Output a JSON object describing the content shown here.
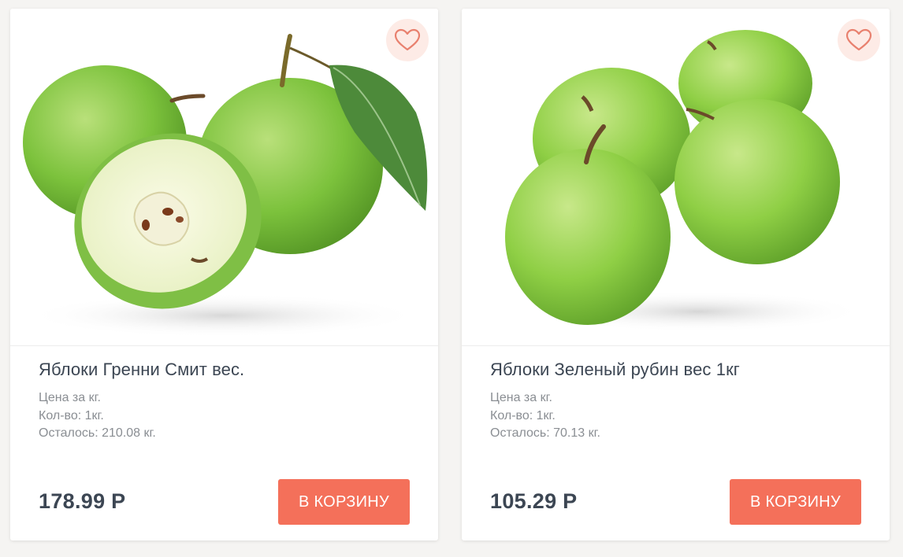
{
  "products": [
    {
      "image": "green-apples-granny-smith-with-half-and-leaf",
      "title": "Яблоки Гренни Смит вес.",
      "price_note": "Цена за кг.",
      "quantity": "Кол-во: 1кг.",
      "remaining": "Осталось: 210.08 кг.",
      "price": "178.99 Р",
      "button_label": "В КОРЗИНУ"
    },
    {
      "image": "four-green-apples-green-ruby",
      "title": "Яблоки Зеленый рубин вес 1кг",
      "price_note": "Цена за кг.",
      "quantity": "Кол-во: 1кг.",
      "remaining": "Осталось: 70.13 кг.",
      "price": "105.29 Р",
      "button_label": "В КОРЗИНУ"
    }
  ],
  "icons": {
    "favorite": "heart-outline-icon"
  },
  "colors": {
    "accent": "#f4705a",
    "favorite_bg": "#fdebe6",
    "heart_stroke": "#e8806e",
    "title_text": "#3c4653",
    "muted_text": "#8a8e93",
    "page_bg": "#f5f4f2"
  }
}
